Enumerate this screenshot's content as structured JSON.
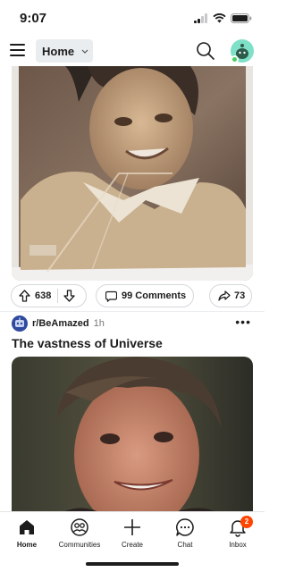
{
  "status_bar": {
    "time": "9:07"
  },
  "header": {
    "feed_selector": "Home"
  },
  "posts": [
    {
      "image_desc_icon": "vintage-photo",
      "votes": "638",
      "comments_label": "99 Comments",
      "shares": "73"
    },
    {
      "subreddit": "r/BeAmazed",
      "age": "1h",
      "title": "The vastness of Universe"
    }
  ],
  "bottom_nav": {
    "items": [
      {
        "label": "Home",
        "icon": "home-icon"
      },
      {
        "label": "Communities",
        "icon": "communities-icon"
      },
      {
        "label": "Create",
        "icon": "plus-icon"
      },
      {
        "label": "Chat",
        "icon": "chat-icon"
      },
      {
        "label": "Inbox",
        "icon": "bell-icon"
      }
    ],
    "inbox_badge": "2"
  },
  "colors": {
    "accent": "#ff4500",
    "pill_border": "#d4d7d9",
    "feed_select_bg": "#eaedef"
  }
}
